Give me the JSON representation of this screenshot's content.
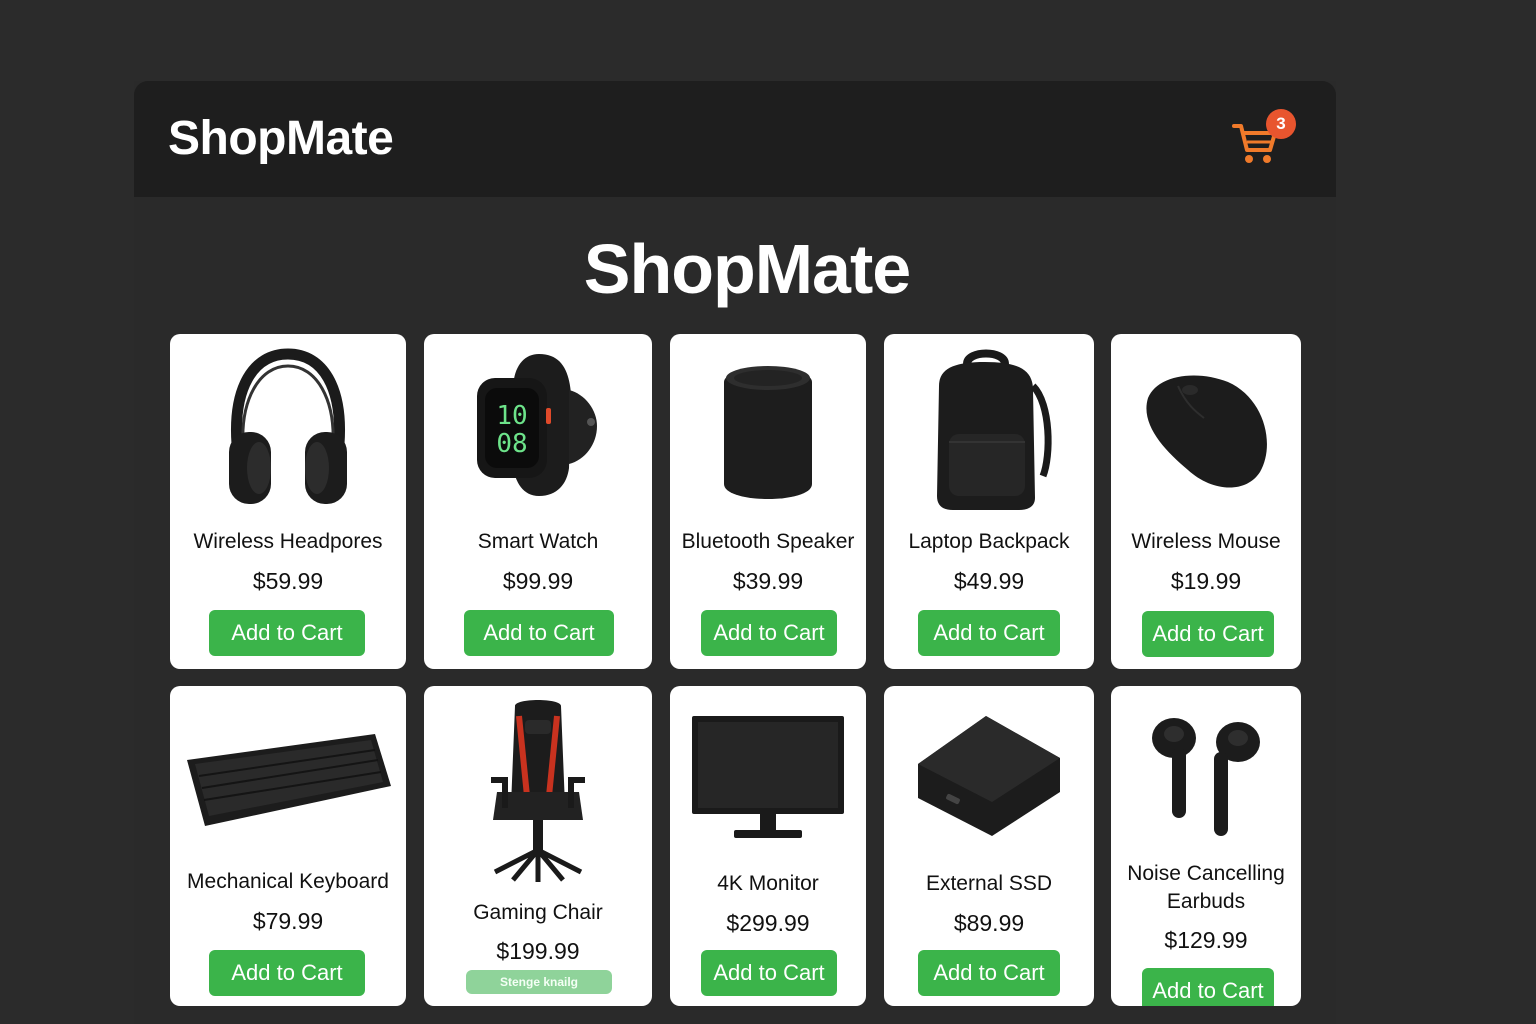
{
  "header": {
    "brand": "ShopMate",
    "cart": {
      "count": "3",
      "badge_color": "#e8552e",
      "icon_color": "#f07a2a"
    }
  },
  "main": {
    "title": "ShopMate"
  },
  "products": [
    {
      "name": "Wireless Headpores",
      "price": "$59.99",
      "button": "Add to Cart",
      "icon": "headphones-icon"
    },
    {
      "name": "Smart Watch",
      "price": "$99.99",
      "button": "Add to Cart",
      "icon": "smartwatch-icon",
      "watch_hour": "10",
      "watch_minute": "08"
    },
    {
      "name": "Bluetooth Speaker",
      "price": "$39.99",
      "button": "Add to Cart",
      "icon": "speaker-icon"
    },
    {
      "name": "Laptop Backpack",
      "price": "$49.99",
      "button": "Add to Cart",
      "icon": "backpack-icon"
    },
    {
      "name": "Wireless Mouse",
      "price": "$19.99",
      "button": "Add to Cart",
      "icon": "mouse-icon"
    },
    {
      "name": "Mechanical Keyboard",
      "price": "$79.99",
      "button": "Add to Cart",
      "icon": "keyboard-icon"
    },
    {
      "name": "Gaming Chair",
      "price": "$199.99",
      "button": "Stenge knailg",
      "icon": "gaming-chair-icon"
    },
    {
      "name": "4K Monitor",
      "price": "$299.99",
      "button": "Add to Cart",
      "icon": "monitor-icon"
    },
    {
      "name": "External SSD",
      "price": "$89.99",
      "button": "Add to Cart",
      "icon": "ssd-icon"
    },
    {
      "name": "Noise Cancelling Earbuds",
      "price": "$129.99",
      "button": "Add to Cart",
      "icon": "earbuds-icon"
    }
  ],
  "colors": {
    "button": "#3bb44a",
    "button_faded": "#8fd39a",
    "page_bg": "#2b2b2b",
    "header_bg": "#1e1e1e"
  }
}
